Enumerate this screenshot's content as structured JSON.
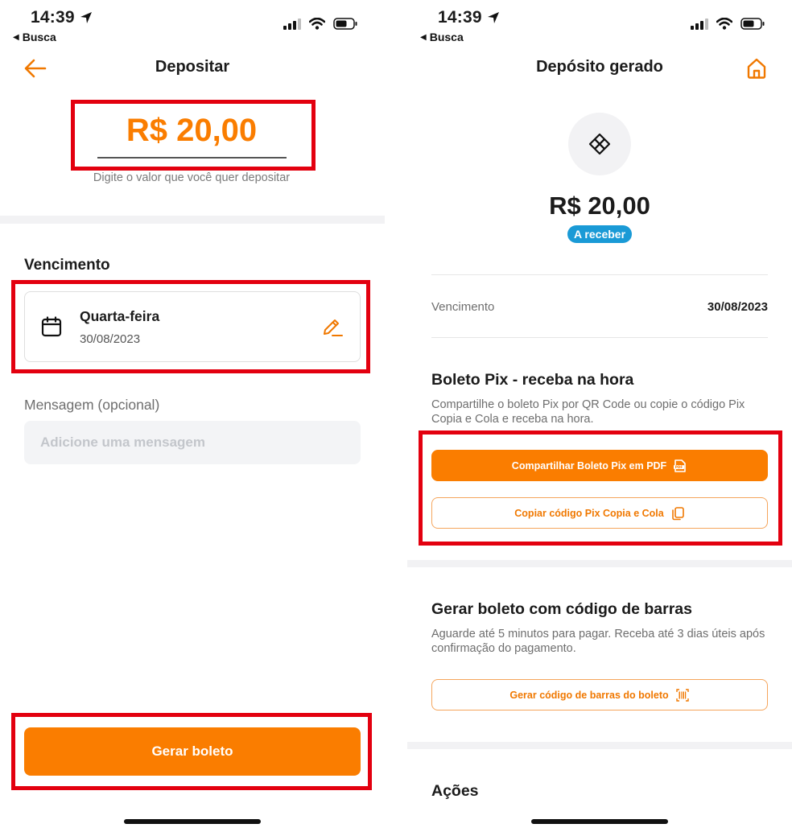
{
  "left": {
    "status": {
      "time": "14:39",
      "back": "Busca"
    },
    "nav_title": "Depositar",
    "amount": "R$ 20,00",
    "amount_hint": "Digite o valor que você quer depositar",
    "due_section_title": "Vencimento",
    "due_day": "Quarta-feira",
    "due_date": "30/08/2023",
    "message_label": "Mensagem (opcional)",
    "message_placeholder": "Adicione uma mensagem",
    "generate_button": "Gerar boleto"
  },
  "right": {
    "status": {
      "time": "14:39",
      "back": "Busca"
    },
    "nav_title": "Depósito gerado",
    "amount": "R$ 20,00",
    "status_badge": "A receber",
    "due_label": "Vencimento",
    "due_value": "30/08/2023",
    "pix_title": "Boleto Pix - receba na hora",
    "pix_description": "Compartilhe o boleto Pix por QR Code ou copie o código Pix Copia e Cola e receba na hora.",
    "share_pdf_button": "Compartilhar Boleto Pix em PDF",
    "copy_pix_button": "Copiar código Pix Copia e Cola",
    "barcode_title": "Gerar boleto com código de barras",
    "barcode_description": "Aguarde até 5 minutos para pagar. Receba até 3 dias úteis após confirmação do pagamento.",
    "barcode_button": "Gerar código de barras do boleto",
    "actions_title": "Ações"
  },
  "colors": {
    "accent": "#fa7d00",
    "badge": "#1a9ad6",
    "highlight": "#e3000f"
  }
}
